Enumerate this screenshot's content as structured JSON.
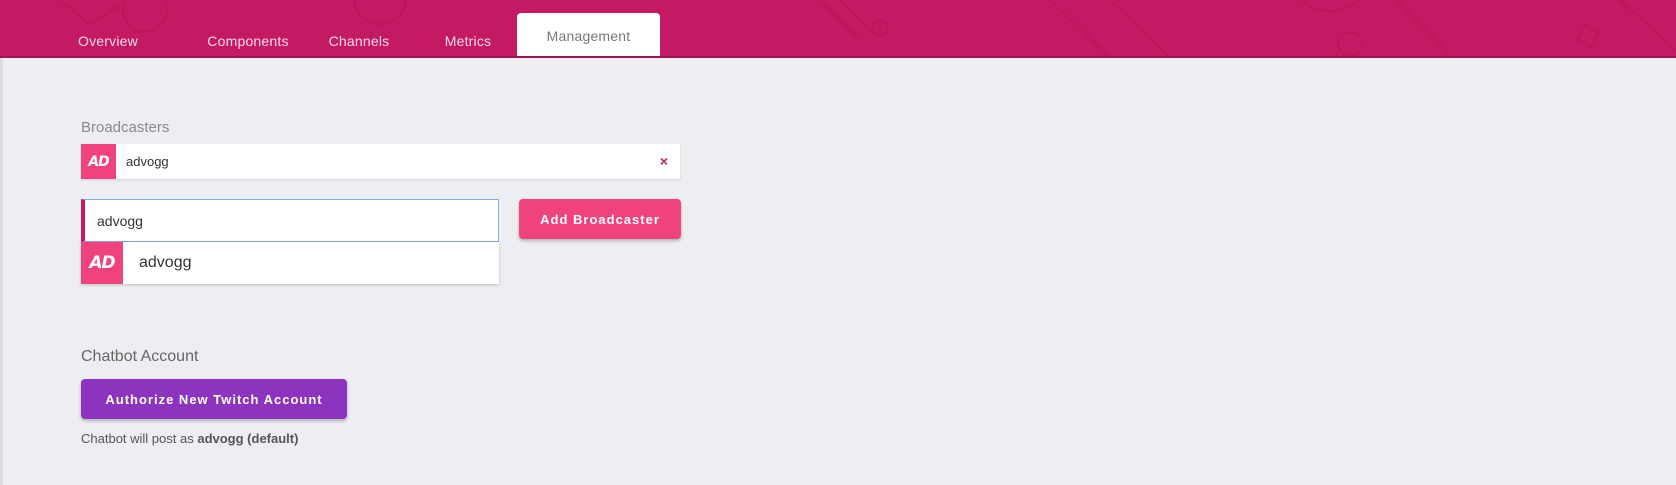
{
  "tabs": [
    {
      "label": "Overview",
      "active": false
    },
    {
      "label": "Components",
      "active": false
    },
    {
      "label": "Channels",
      "active": false
    },
    {
      "label": "Metrics",
      "active": false
    },
    {
      "label": "Management",
      "active": true
    }
  ],
  "colors": {
    "header": "#c41a63",
    "accent_pink": "#f0437e",
    "accent_purple": "#8c34bd",
    "background": "#edeef1"
  },
  "broadcasters": {
    "title": "Broadcasters",
    "list": [
      {
        "logo_text": "AD",
        "name": "advogg",
        "remove_icon": "×"
      }
    ],
    "search_input_value": "advogg",
    "suggestions": [
      {
        "logo_text": "AD",
        "name": "advogg"
      }
    ],
    "add_button_label": "Add Broadcaster"
  },
  "chatbot": {
    "title": "Chatbot Account",
    "authorize_button_label": "Authorize New Twitch Account",
    "note_prefix": "Chatbot will post as ",
    "note_account": "advogg (default)"
  }
}
